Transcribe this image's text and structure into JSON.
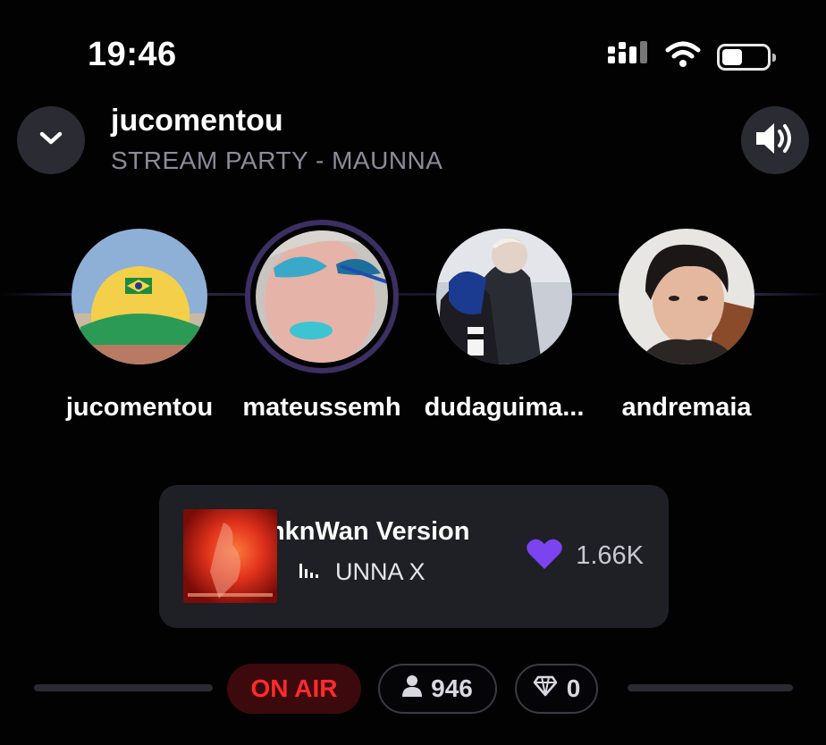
{
  "status_bar": {
    "time": "19:46"
  },
  "header": {
    "host": "jucomentou",
    "title": "STREAM PARTY - MAUNNA"
  },
  "participants": [
    {
      "name": "jucomentou"
    },
    {
      "name": "mateussemh",
      "active": true
    },
    {
      "name": "dudaguima..."
    },
    {
      "name": "andremaia"
    }
  ],
  "now_playing": {
    "track": "UnknWan Version",
    "artist": "UNNA X",
    "likes": "1.66K"
  },
  "footer": {
    "on_air": "ON AIR",
    "listeners": "946",
    "gems": "0"
  },
  "colors": {
    "accent": "#7b44f0",
    "on_air": "#ff2b2b",
    "card": "#1f1f26"
  }
}
